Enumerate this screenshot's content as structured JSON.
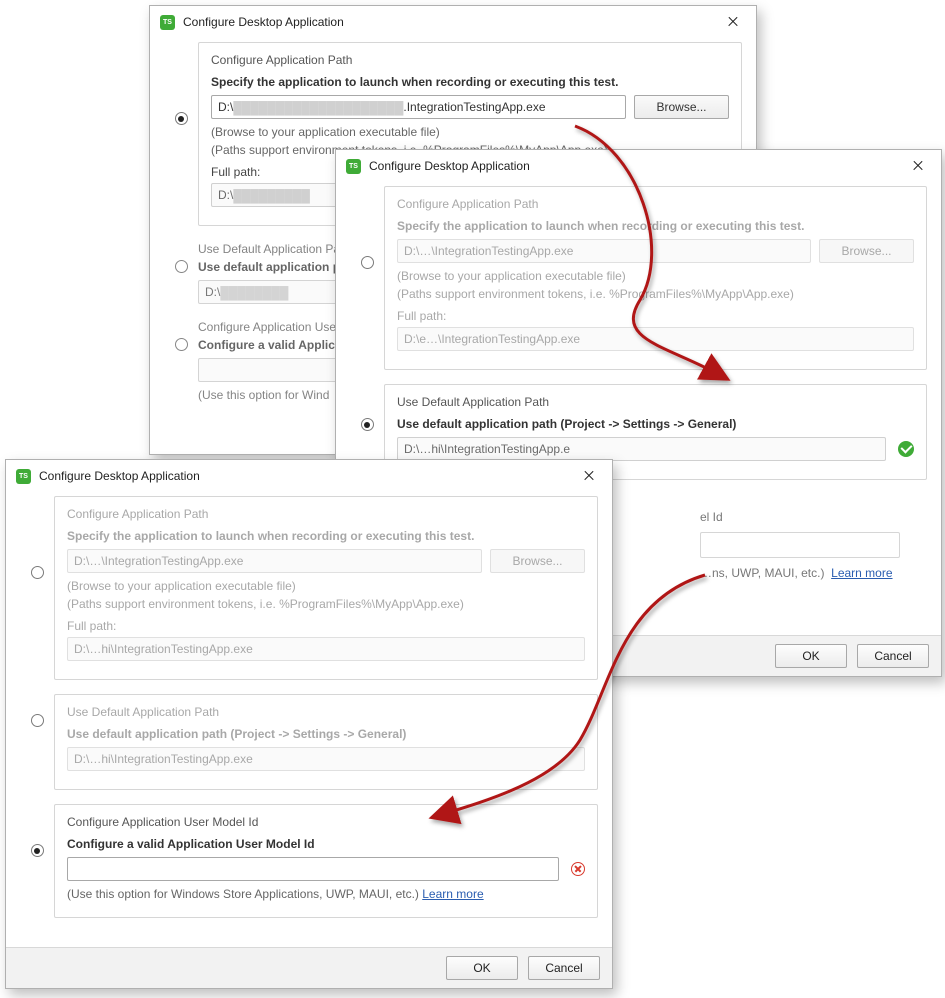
{
  "common": {
    "window_title": "Configure Desktop Application",
    "section1_title": "Configure Application Path",
    "section1_help": "Specify the application to launch when recording or executing this test.",
    "browse": "Browse...",
    "browse_help": "(Browse to your application executable file)",
    "paths_help": "(Paths support environment tokens, i.e. %ProgramFiles%\\MyApp\\App.exe)",
    "full_path_label": "Full path:",
    "section2_title": "Use Default Application Path",
    "section2_help": "Use default application path (Project -> Settings -> General)",
    "section3_title": "Configure Application User Model Id",
    "section3_help": "Configure a valid Application User Model Id",
    "section3_explain_prefix": "(Use this option for Windows Store Applications, UWP, MAUI, etc.)  ",
    "learn_more": "Learn more",
    "ok": "OK",
    "cancel": "Cancel"
  },
  "dialog1": {
    "path_input_prefix": "D:\\",
    "path_input_suffix": ".IntegrationTestingApp.exe",
    "full_path_prefix": "D:\\",
    "cropped_default": "Use Default Application Pat",
    "cropped_default2": "Use default application p",
    "cropped_default3_prefix": "D:\\",
    "cropped_usermodel": "Configure Application User",
    "cropped_usermodel2": "Configure a valid Applic",
    "cropped_usermodel3": "(Use this option for Wind"
  },
  "dialog2": {
    "path_input": "D:\\…\\IntegrationTestingApp.exe",
    "full_path": "D:\\e…\\IntegrationTestingApp.exe",
    "default_path": "D:\\…hi\\IntegrationTestingApp.e",
    "usermodel_title_partial": "el Id",
    "usermodel_explain_partial": "…ns, UWP, MAUI, etc.)"
  },
  "dialog3": {
    "path_input": "D:\\…\\IntegrationTestingApp.exe",
    "full_path": "D:\\…hi\\IntegrationTestingApp.exe",
    "default_path": "D:\\…hi\\IntegrationTestingApp.exe"
  }
}
